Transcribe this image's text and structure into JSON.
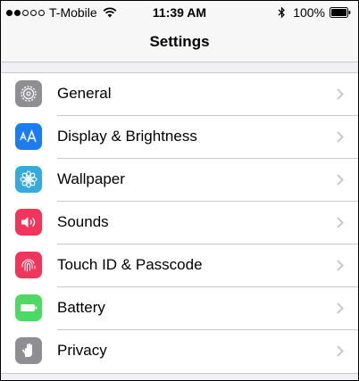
{
  "status_bar": {
    "carrier": "T-Mobile",
    "signal_filled": 2,
    "signal_total": 5,
    "time": "11:39 AM",
    "battery_percent": "100%"
  },
  "nav": {
    "title": "Settings"
  },
  "settings": [
    {
      "label": "General",
      "icon": "gear-icon",
      "color": "#8e8e93"
    },
    {
      "label": "Display & Brightness",
      "icon": "text-size-icon",
      "color": "#1b7cf3"
    },
    {
      "label": "Wallpaper",
      "icon": "flower-icon",
      "color": "#36aadc"
    },
    {
      "label": "Sounds",
      "icon": "speaker-icon",
      "color": "#f2355b"
    },
    {
      "label": "Touch ID & Passcode",
      "icon": "fingerprint-icon",
      "color": "#f2355b"
    },
    {
      "label": "Battery",
      "icon": "battery-icon",
      "color": "#4cd964"
    },
    {
      "label": "Privacy",
      "icon": "hand-icon",
      "color": "#8e8e93"
    }
  ]
}
